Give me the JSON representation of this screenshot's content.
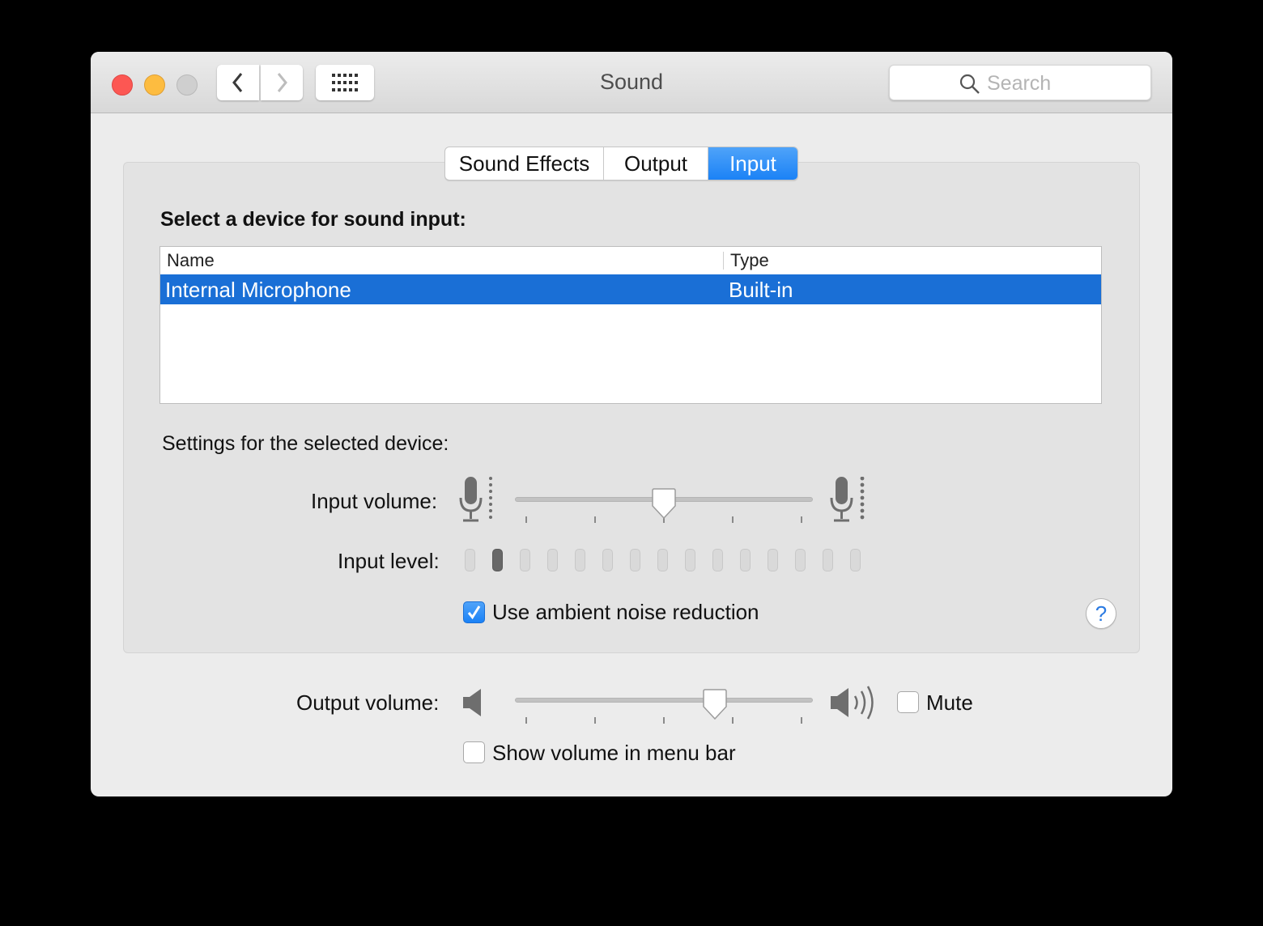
{
  "window": {
    "title": "Sound"
  },
  "search": {
    "placeholder": "Search"
  },
  "tabs": [
    {
      "label": "Sound Effects",
      "active": false
    },
    {
      "label": "Output",
      "active": false
    },
    {
      "label": "Input",
      "active": true
    }
  ],
  "input_panel": {
    "heading": "Select a device for sound input:",
    "table": {
      "columns": [
        "Name",
        "Type"
      ],
      "rows": [
        {
          "name": "Internal Microphone",
          "type": "Built-in",
          "selected": true
        }
      ]
    },
    "settings_heading": "Settings for the selected device:",
    "input_volume": {
      "label": "Input volume:",
      "value": 0.5
    },
    "input_level": {
      "label": "Input level:",
      "segments": 15,
      "active_segments": [
        1
      ]
    },
    "noise_reduction": {
      "label": "Use ambient noise reduction",
      "checked": true
    },
    "help": {
      "label": "?"
    }
  },
  "output": {
    "volume_label": "Output volume:",
    "volume": 0.67,
    "mute_label": "Mute",
    "mute_checked": false,
    "menu_bar_label": "Show volume in menu bar",
    "menu_bar_checked": false
  },
  "colors": {
    "accent": "#1b82f6",
    "selection": "#1a6fd6",
    "close": "#fc5753",
    "minimize": "#fdbc40"
  },
  "icons": [
    "close-light",
    "minimize-light",
    "zoom-light",
    "chevron-left-icon",
    "chevron-right-icon",
    "grid-icon",
    "search-icon",
    "microphone-icon",
    "speaker-icon",
    "checkmark-icon",
    "help-icon"
  ]
}
